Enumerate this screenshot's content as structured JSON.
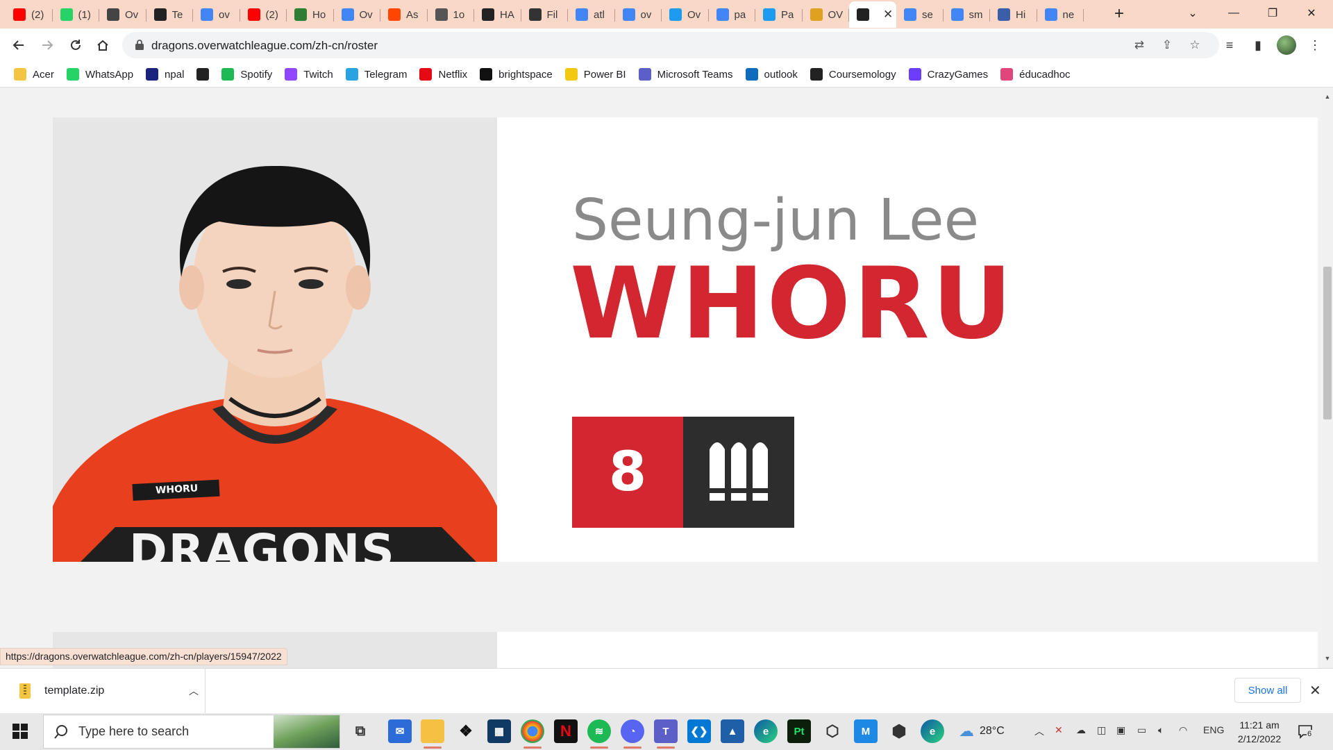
{
  "tabs": [
    {
      "title": "(2)",
      "icon": "youtube-icon",
      "color": "#ff0000"
    },
    {
      "title": "(1)",
      "icon": "whatsapp-icon",
      "color": "#25d366"
    },
    {
      "title": "Ov",
      "icon": "overwatch-icon",
      "color": "#444444"
    },
    {
      "title": "Te",
      "icon": "team-icon",
      "color": "#222222"
    },
    {
      "title": "ov",
      "icon": "google-icon",
      "color": "#4285f4"
    },
    {
      "title": "(2)",
      "icon": "youtube-icon",
      "color": "#ff0000"
    },
    {
      "title": "Ho",
      "icon": "wiki-icon",
      "color": "#2e7d32"
    },
    {
      "title": "Ov",
      "icon": "google-icon",
      "color": "#4285f4"
    },
    {
      "title": "As",
      "icon": "reddit-icon",
      "color": "#ff4500"
    },
    {
      "title": "1o",
      "icon": "globe-icon",
      "color": "#555555"
    },
    {
      "title": "HA",
      "icon": "team-icon",
      "color": "#222222"
    },
    {
      "title": "Fil",
      "icon": "pinwheel-icon",
      "color": "#333333"
    },
    {
      "title": "atl",
      "icon": "google-icon",
      "color": "#4285f4"
    },
    {
      "title": "ov",
      "icon": "google-icon",
      "color": "#4285f4"
    },
    {
      "title": "Ov",
      "icon": "twitter-icon",
      "color": "#1d9bf0"
    },
    {
      "title": "pa",
      "icon": "google-icon",
      "color": "#4285f4"
    },
    {
      "title": "Pa",
      "icon": "twitter-icon",
      "color": "#1d9bf0"
    },
    {
      "title": "OV",
      "icon": "coin-icon",
      "color": "#e0a020"
    },
    {
      "title": "",
      "icon": "team-icon",
      "color": "#222222",
      "active": true
    },
    {
      "title": "se",
      "icon": "google-icon",
      "color": "#4285f4"
    },
    {
      "title": "sm",
      "icon": "google-icon",
      "color": "#4285f4"
    },
    {
      "title": "Hi",
      "icon": "globe-icon",
      "color": "#3a5fa8"
    },
    {
      "title": "ne",
      "icon": "google-icon",
      "color": "#4285f4"
    }
  ],
  "address_bar": {
    "url": "dragons.overwatchleague.com/zh-cn/roster"
  },
  "bookmarks": [
    {
      "label": "Acer",
      "icon": "folder-icon",
      "color": "#f4c542"
    },
    {
      "label": "WhatsApp",
      "icon": "whatsapp-icon",
      "color": "#25d366"
    },
    {
      "label": "npal",
      "icon": "npal-icon",
      "color": "#1a237e"
    },
    {
      "label": "",
      "icon": "globe-icon",
      "color": "#222222"
    },
    {
      "label": "Spotify",
      "icon": "spotify-icon",
      "color": "#1db954"
    },
    {
      "label": "Twitch",
      "icon": "twitch-icon",
      "color": "#9146ff"
    },
    {
      "label": "Telegram",
      "icon": "telegram-icon",
      "color": "#2aa3e1"
    },
    {
      "label": "Netflix",
      "icon": "netflix-icon",
      "color": "#e50914"
    },
    {
      "label": "brightspace",
      "icon": "np-icon",
      "color": "#111111"
    },
    {
      "label": "Power BI",
      "icon": "powerbi-icon",
      "color": "#f2c811"
    },
    {
      "label": "Microsoft Teams",
      "icon": "teams-icon",
      "color": "#5b5fc7"
    },
    {
      "label": "outlook",
      "icon": "outlook-icon",
      "color": "#0f6cbd"
    },
    {
      "label": "Coursemology",
      "icon": "coursemology-icon",
      "color": "#222222"
    },
    {
      "label": "CrazyGames",
      "icon": "crazygames-icon",
      "color": "#6c3cff"
    },
    {
      "label": "éducadhoc",
      "icon": "educadhoc-icon",
      "color": "#e0457b"
    }
  ],
  "player": {
    "real_name": "Seung-jun Lee",
    "handle": "WHORU",
    "number": "8",
    "role_icon": "damage-role-icon",
    "jersey_name": "WHORU",
    "jersey_team": "DRAGONS",
    "accent": "#d22630"
  },
  "status_url": "https://dragons.overwatchleague.com/zh-cn/players/15947/2022",
  "download": {
    "file": "template.zip",
    "show_all": "Show all"
  },
  "taskbar": {
    "search_placeholder": "Type here to search",
    "temperature": "28°C",
    "language": "ENG",
    "time": "11:21 am",
    "date": "2/12/2022",
    "notifications": "6"
  }
}
